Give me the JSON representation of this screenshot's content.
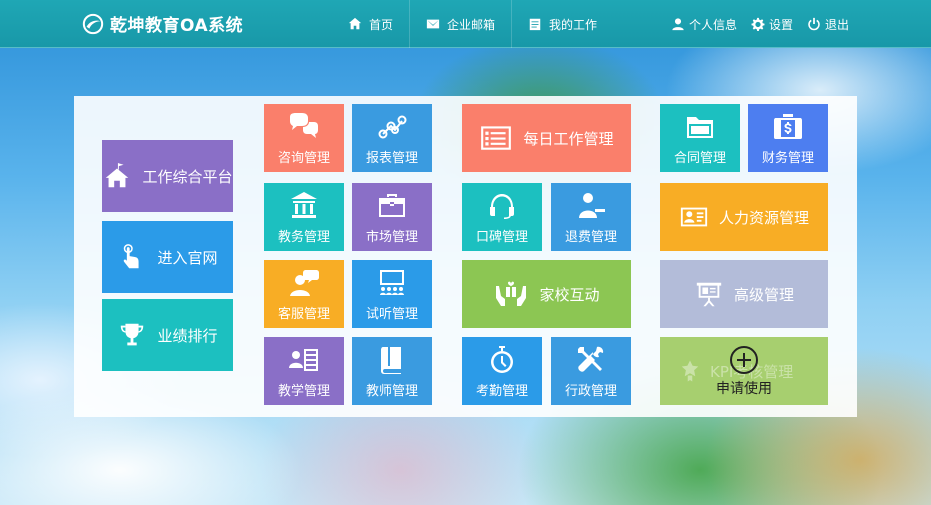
{
  "header": {
    "title": "乾坤教育OA系统",
    "nav": [
      "首页",
      "企业邮箱",
      "我的工作"
    ],
    "user_nav": [
      "个人信息",
      "设置",
      "退出"
    ]
  },
  "left": {
    "platform": "工作综合平台",
    "website": "进入官网",
    "ranking": "业绩排行"
  },
  "tiles": {
    "consult": "咨询管理",
    "report": "报表管理",
    "daily": "每日工作管理",
    "contract": "合同管理",
    "finance": "财务管理",
    "academic": "教务管理",
    "market": "市场管理",
    "reputation": "口碑管理",
    "refund": "退费管理",
    "hr": "人力资源管理",
    "service": "客服管理",
    "trial": "试听管理",
    "homeschool": "家校互动",
    "advanced": "高级管理",
    "teaching": "教学管理",
    "teacher": "教师管理",
    "attendance": "考勤管理",
    "admin": "行政管理",
    "kpi": "KPI考核管理",
    "apply": "申请使用"
  },
  "colors": {
    "header": "#1fa7b5",
    "purple": "#8a6fc7",
    "blue": "#2b9be8",
    "teal": "#1cc0c0",
    "coral": "#fa7f6b",
    "sky": "#3a9be0",
    "orange": "#f8ad25",
    "green": "#8cc653",
    "lavender": "#b3bcd9",
    "kpi": "#a7cf6f"
  }
}
